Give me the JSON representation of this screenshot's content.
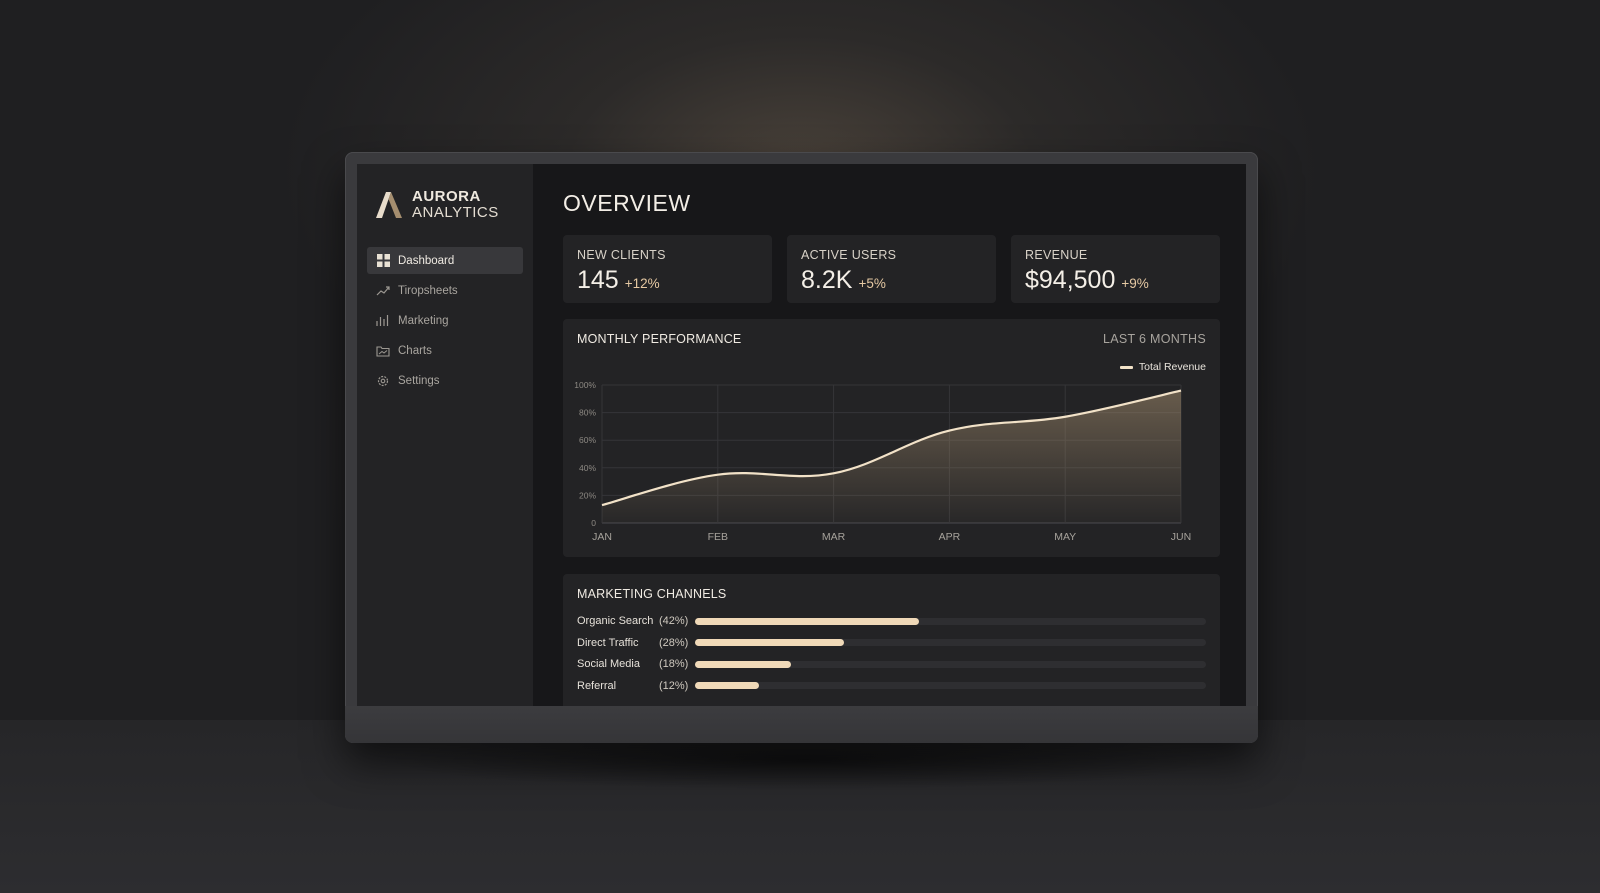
{
  "app": {
    "logo_line1": "AURORA",
    "logo_line2": "ANALYTICS"
  },
  "sidebar": {
    "items": [
      {
        "label": "Dashboard",
        "icon": "grid-icon",
        "active": true
      },
      {
        "label": "Tiropsheets",
        "icon": "trend-line-icon",
        "active": false
      },
      {
        "label": "Marketing",
        "icon": "bar-chart-icon",
        "active": false
      },
      {
        "label": "Charts",
        "icon": "folder-icon",
        "active": false
      },
      {
        "label": "Settings",
        "icon": "gear-icon",
        "active": false
      }
    ]
  },
  "page": {
    "title": "OVERVIEW"
  },
  "kpis": [
    {
      "label": "NEW CLIENTS",
      "value": "145",
      "delta": "+12%"
    },
    {
      "label": "ACTIVE USERS",
      "value": "8.2K",
      "delta": "+5%"
    },
    {
      "label": "REVENUE",
      "value": "$94,500",
      "delta": "+9%"
    }
  ],
  "performance": {
    "title": "MONTHLY PERFORMANCE",
    "range_label": "LAST 6 MONTHS"
  },
  "chart_data": {
    "type": "area",
    "categories": [
      "JAN",
      "FEB",
      "MAR",
      "APR",
      "MAY",
      "JUN"
    ],
    "series": [
      {
        "name": "Total Revenue",
        "values": [
          13,
          35,
          36,
          67,
          77,
          96
        ]
      }
    ],
    "y_ticks": [
      "0",
      "20%",
      "40%",
      "60%",
      "80%",
      "100%"
    ],
    "ylim": [
      0,
      100
    ],
    "grid": true,
    "legend_position": "top-right",
    "colors": {
      "line": "#f2e2c8",
      "fill": "#a08a6c"
    }
  },
  "channels": {
    "title": "MARKETING CHANNELS",
    "items": [
      {
        "name": "Organic Search",
        "pct_label": "(42%)",
        "value": 0.42
      },
      {
        "name": "Direct Traffic",
        "pct_label": "(28%)",
        "value": 0.28
      },
      {
        "name": "Social Media",
        "pct_label": "(18%)",
        "value": 0.18
      },
      {
        "name": "Referral",
        "pct_label": "(12%)",
        "value": 0.12
      }
    ]
  },
  "colors": {
    "accent": "#f0d9b8",
    "delta": "#e6c9a3",
    "panel": "#232325",
    "screen_bg": "#171719"
  }
}
